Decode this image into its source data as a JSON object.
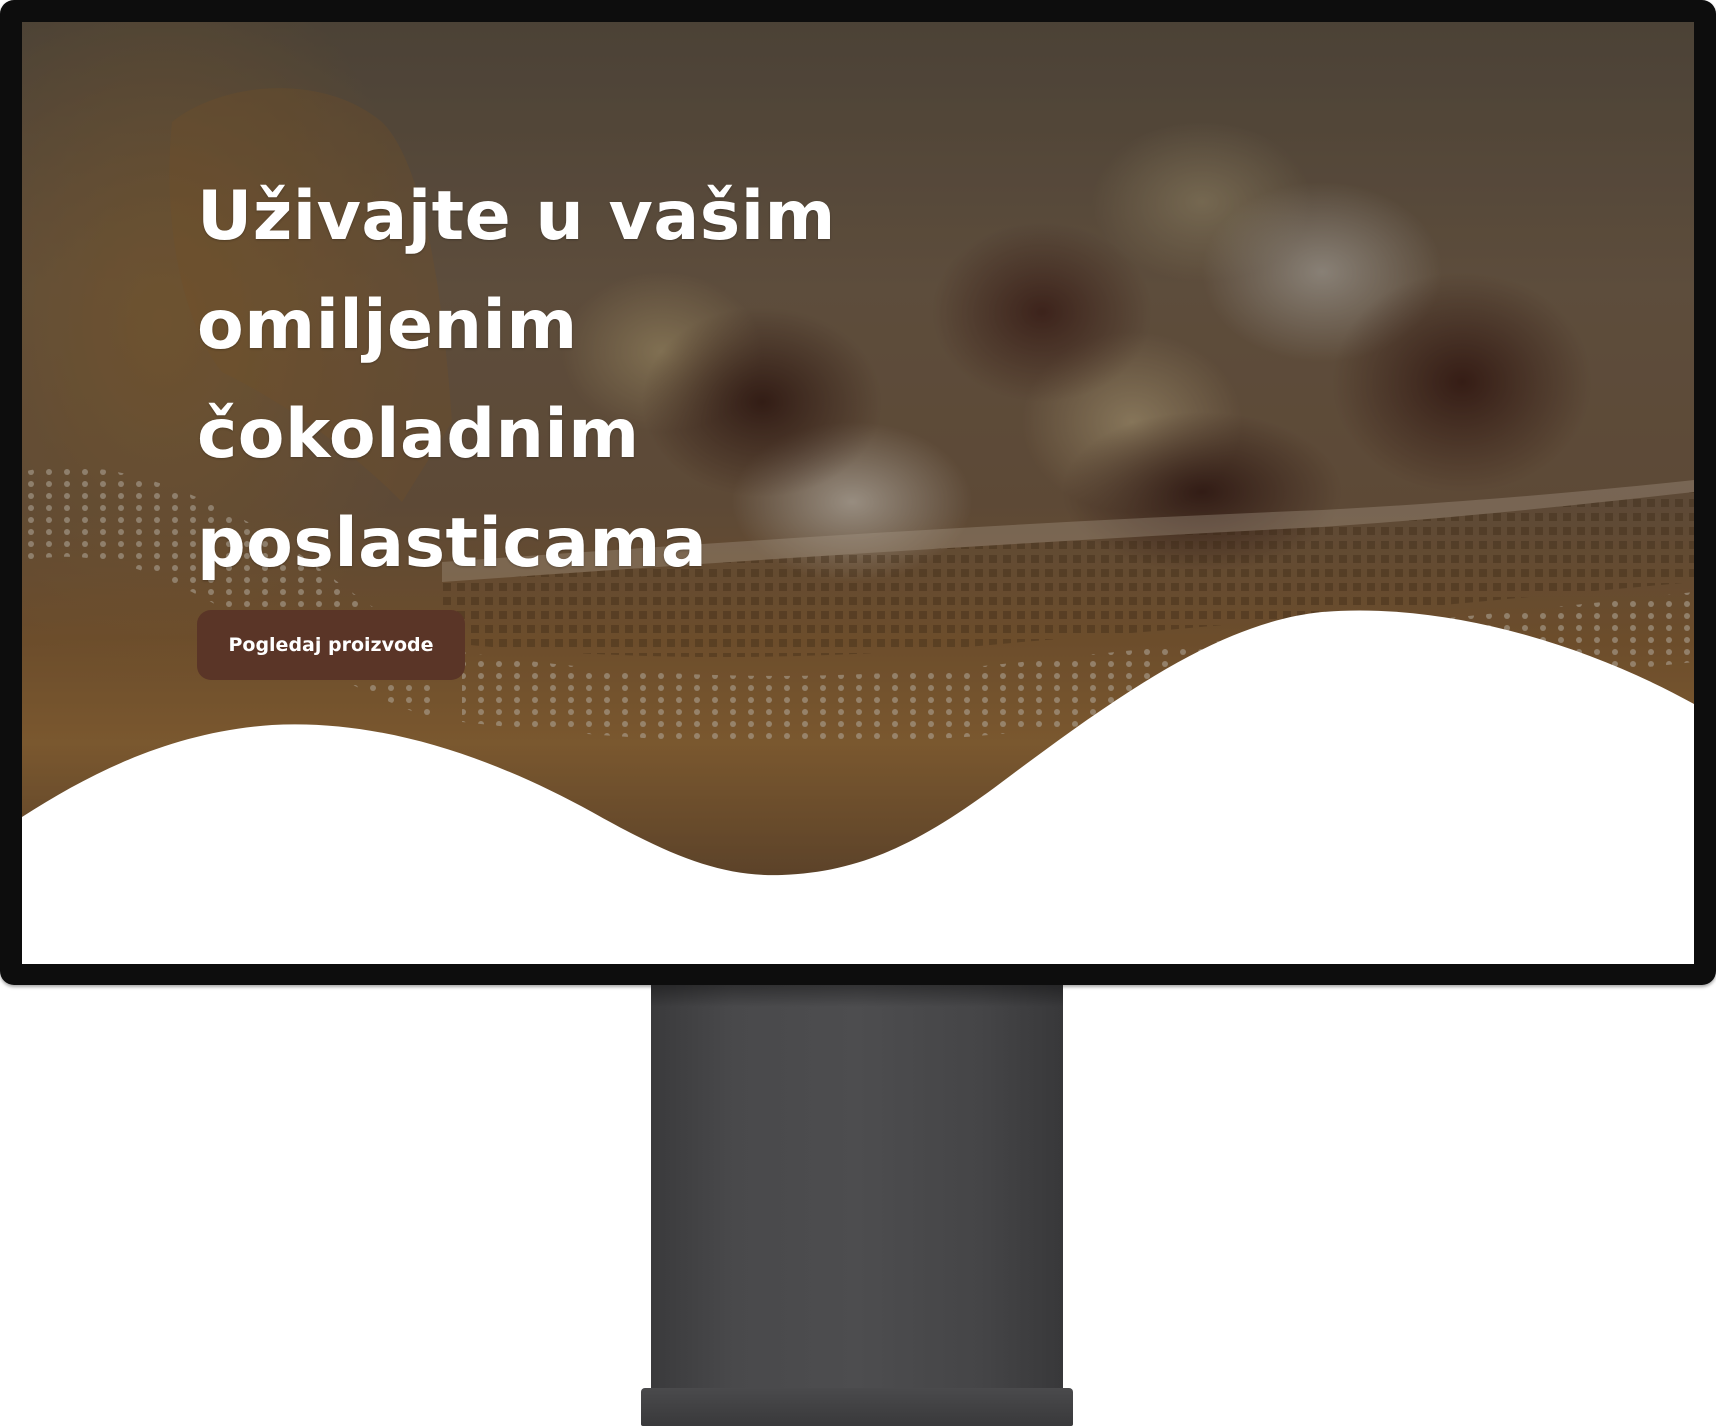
{
  "hero": {
    "title_lines": [
      "Uživajte u vašim",
      "omiljenim",
      "čokoladnim",
      "poslasticama"
    ],
    "cta_label": "Pogledaj proizvode",
    "accent_color": "#5a3527",
    "background_image": "chocolate-truffles-in-burlap-basket"
  }
}
